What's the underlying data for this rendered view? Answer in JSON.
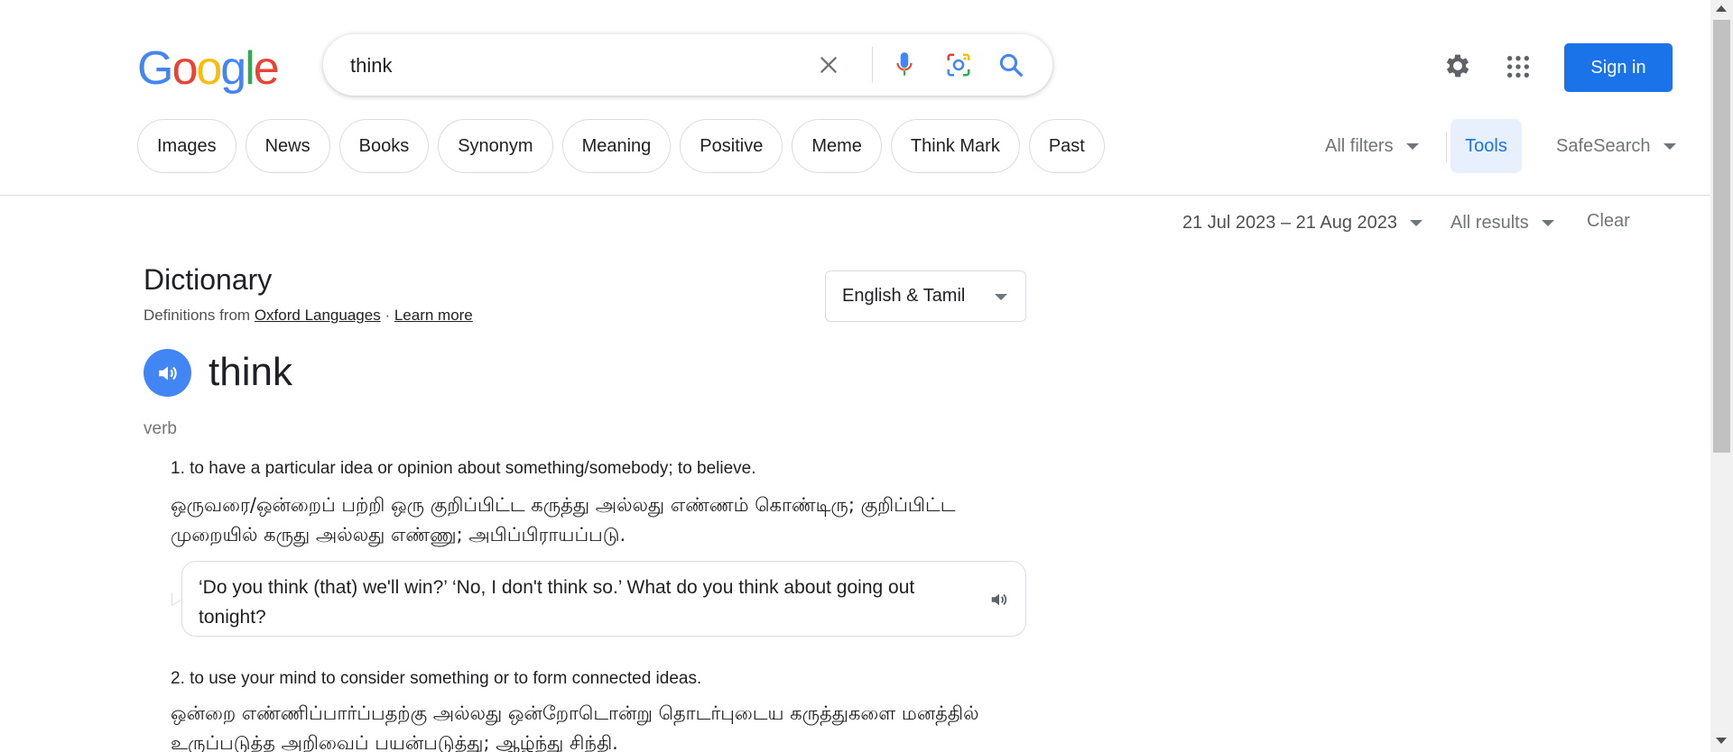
{
  "header": {
    "logo_letters": [
      "G",
      "o",
      "o",
      "g",
      "l",
      "e"
    ],
    "search": {
      "query": "think"
    },
    "signin_label": "Sign in"
  },
  "chips": [
    "Images",
    "News",
    "Books",
    "Synonym",
    "Meaning",
    "Positive",
    "Meme",
    "Think Mark",
    "Past"
  ],
  "toolbar": {
    "all_filters": "All filters",
    "tools": "Tools",
    "safesearch": "SafeSearch"
  },
  "tools_row": {
    "date_range": "21 Jul 2023 – 21 Aug 2023",
    "all_results": "All results",
    "clear": "Clear"
  },
  "dictionary": {
    "title": "Dictionary",
    "source_prefix": "Definitions from ",
    "source_link": "Oxford Languages",
    "separator": " · ",
    "learn_more": "Learn more",
    "language": "English & Tamil",
    "word": "think",
    "part_of_speech": "verb",
    "definitions": [
      {
        "text": "1. to have a particular idea or opinion about something/somebody; to believe.",
        "tamil": "ஒருவரை/ஒன்றைப் பற்றி ஒரு குறிப்பிட்ட கருத்து அல்லது எண்ணம் கொண்டிரு; குறிப்பிட்ட முறையில் கருது அல்லது எண்ணு; அபிப்பிராயப்படு.",
        "example": "‘Do you think (that) we'll win?’ ‘No, I don't think so.’ What do you think about going out tonight?"
      },
      {
        "text": "2. to use your mind to consider something or to form connected ideas.",
        "tamil": "ஒன்றை எண்ணிப்பார்ப்பதற்கு அல்லது ஒன்றோடொன்று தொடர்புடைய கருத்துகளை மனத்தில் உருப்படுத்த அறிவைப் பயன்படுத்து; ஆழ்ந்து சிந்தி."
      }
    ]
  },
  "colors": {
    "google_blue": "#4285f4",
    "google_red": "#ea4335",
    "google_yellow": "#fbbc05",
    "google_green": "#34a853",
    "signin_bg": "#1a73e8",
    "tools_bg": "#e8f0fe"
  },
  "icons": [
    "close-icon",
    "microphone-icon",
    "lens-icon",
    "search-icon",
    "gear-icon",
    "apps-grid-icon",
    "speaker-icon"
  ]
}
